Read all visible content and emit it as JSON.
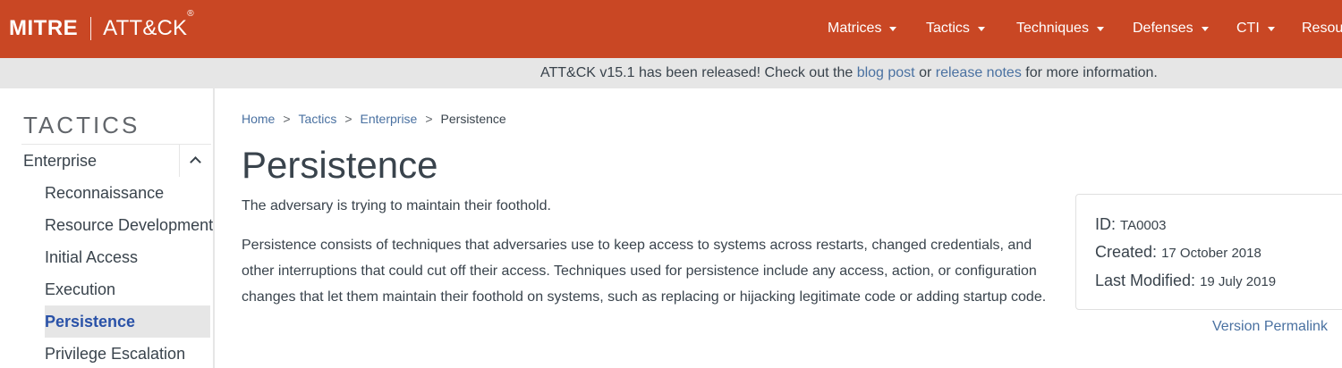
{
  "brand": {
    "mitre": "MITRE",
    "attck": "ATT&CK",
    "reg": "®"
  },
  "nav": {
    "items": [
      {
        "label": "Matrices"
      },
      {
        "label": "Tactics"
      },
      {
        "label": "Techniques"
      },
      {
        "label": "Defenses"
      },
      {
        "label": "CTI"
      },
      {
        "label": "Resou"
      }
    ]
  },
  "banner": {
    "prefix": "ATT&CK v15.1 has been released! Check out the ",
    "blog_link": "blog post",
    "middle": " or ",
    "notes_link": "release notes",
    "suffix": " for more information."
  },
  "sidebar": {
    "title": "TACTICS",
    "section": "Enterprise",
    "items": [
      {
        "label": "Reconnaissance"
      },
      {
        "label": "Resource Development"
      },
      {
        "label": "Initial Access"
      },
      {
        "label": "Execution"
      },
      {
        "label": "Persistence"
      },
      {
        "label": "Privilege Escalation"
      }
    ]
  },
  "breadcrumb": {
    "items": [
      "Home",
      "Tactics",
      "Enterprise"
    ],
    "separator": ">",
    "current": "Persistence"
  },
  "main": {
    "title": "Persistence",
    "intro": "The adversary is trying to maintain their foothold.",
    "description": "Persistence consists of techniques that adversaries use to keep access to systems across restarts, changed credentials, and other interruptions that could cut off their access. Techniques used for persistence include any access, action, or configuration changes that let them maintain their foothold on systems, such as replacing or hijacking legitimate code or adding startup code."
  },
  "card": {
    "id_label": "ID:",
    "id_value": "TA0003",
    "created_label": "Created:",
    "created_value": "17 October 2018",
    "modified_label": "Last Modified:",
    "modified_value": "19 July 2019",
    "permalink": "Version Permalink"
  },
  "colors": {
    "brand": "#c94724",
    "banner_bg": "#e6e6e6",
    "link": "#4a71a1",
    "active_item": "#2a52a8",
    "text": "#39434c"
  },
  "icons": {
    "caret": "caret-down-icon",
    "collapse": "chevron-up-icon"
  }
}
